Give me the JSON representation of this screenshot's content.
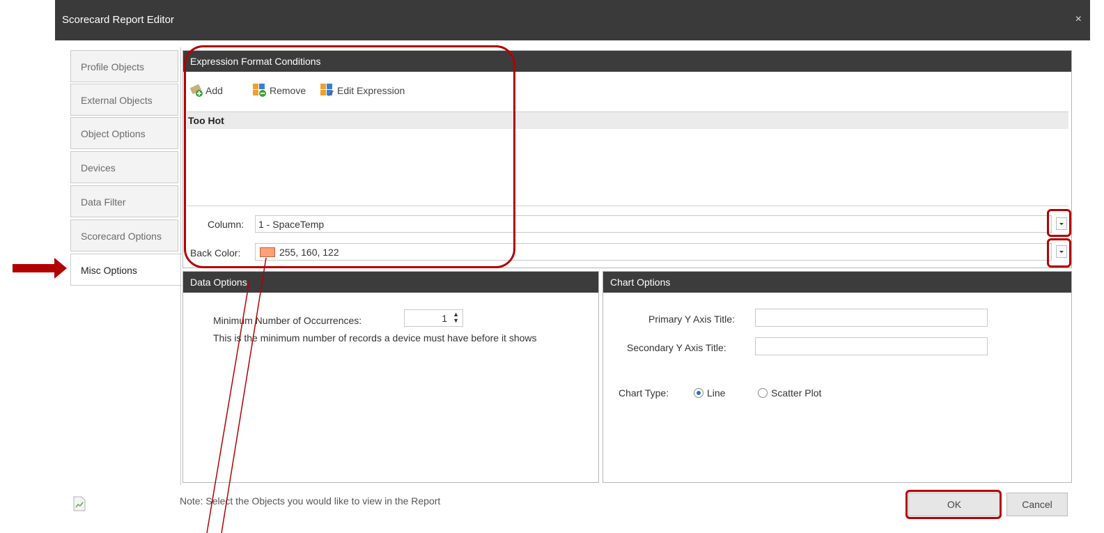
{
  "window": {
    "title": "Scorecard Report Editor",
    "close": "×"
  },
  "tabs": [
    {
      "label": "Profile Objects"
    },
    {
      "label": "External Objects"
    },
    {
      "label": "Object Options"
    },
    {
      "label": "Devices"
    },
    {
      "label": "Data Filter"
    },
    {
      "label": "Scorecard Options"
    },
    {
      "label": "Misc Options"
    }
  ],
  "expression": {
    "header": "Expression Format Conditions",
    "toolbar": {
      "add": "Add",
      "remove": "Remove",
      "edit": "Edit Expression"
    },
    "items": [
      "Too Hot"
    ],
    "column_label": "Column:",
    "column_value": "1 - SpaceTemp",
    "back_color_label": "Back Color:",
    "back_color_value": "255, 160, 122",
    "back_color_swatch": "#ffa07a"
  },
  "data_options": {
    "header": "Data Options",
    "min_label": "Minimum Number of Occurrences:",
    "min_value": "1",
    "description": "This is the minimum number of records a device must have before it shows"
  },
  "chart_options": {
    "header": "Chart Options",
    "primary_label": "Primary Y Axis Title:",
    "primary_value": "",
    "secondary_label": "Secondary Y Axis Title:",
    "secondary_value": "",
    "chart_type_label": "Chart Type:",
    "options": [
      "Line",
      "Scatter Plot"
    ],
    "selected": "Line"
  },
  "footer": {
    "note": "Note: Select the Objects you would like to view in the Report",
    "ok": "OK",
    "cancel": "Cancel"
  },
  "annotation_color": "#b30000"
}
